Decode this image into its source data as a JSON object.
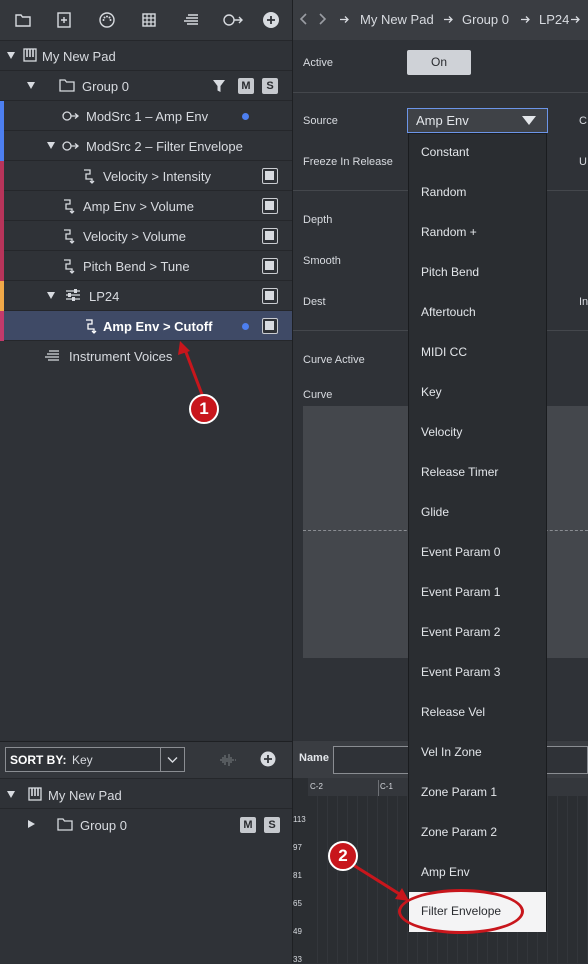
{
  "tree": {
    "root": "My New Pad",
    "group": "Group 0",
    "group_badges": {
      "m": "M",
      "s": "S"
    },
    "rows": [
      {
        "label": "ModSrc 1 – Amp Env"
      },
      {
        "label": "ModSrc 2 – Filter Envelope"
      },
      {
        "label": "Velocity > Intensity"
      },
      {
        "label": "Amp Env > Volume"
      },
      {
        "label": "Velocity > Volume"
      },
      {
        "label": "Pitch Bend > Tune"
      },
      {
        "label": "LP24"
      },
      {
        "label": "Amp Env > Cutoff"
      }
    ],
    "voices": "Instrument Voices"
  },
  "breadcrumb": {
    "items": [
      "My New Pad",
      "Group 0",
      "LP24"
    ]
  },
  "props": {
    "active_label": "Active",
    "active_value": "On",
    "source_label": "Source",
    "source_value": "Amp Env",
    "freeze_label": "Freeze In Release",
    "depth_label": "Depth",
    "smooth_label": "Smooth",
    "dest_label": "Dest",
    "curve_active_label": "Curve Active",
    "curve_label": "Curve",
    "right_cut_1": "C",
    "right_cut_2": "U",
    "right_cut_3": "In"
  },
  "dropdown": {
    "options": [
      "Constant",
      "Random",
      "Random +",
      "Pitch Bend",
      "Aftertouch",
      "MIDI CC",
      "Key",
      "Velocity",
      "Release Timer",
      "Glide",
      "Event Param 0",
      "Event Param 1",
      "Event Param 2",
      "Event Param 3",
      "Release Vel",
      "Vel In Zone",
      "Zone Param 1",
      "Zone Param 2",
      "Amp Env",
      "Filter Envelope"
    ],
    "selected": "Filter Envelope"
  },
  "sort": {
    "label": "SORT BY:",
    "value": "Key"
  },
  "bottom_tree": {
    "root": "My New Pad",
    "group": "Group 0",
    "m": "M",
    "s": "S"
  },
  "name_label": "Name",
  "keyboard": {
    "octaves": [
      "C-2",
      "C-1"
    ],
    "numbers": [
      "113",
      "97",
      "81",
      "65",
      "49",
      "33"
    ]
  },
  "annotations": {
    "one": "1",
    "two": "2"
  },
  "colors": {
    "stripe_blue": "#4d7ff0",
    "stripe_pink": "#b8345a",
    "stripe_orange": "#f0a848",
    "stripe_magenta": "#c23a6b",
    "selected_row": "#3f4a66",
    "annotation_red": "#c8161c"
  }
}
